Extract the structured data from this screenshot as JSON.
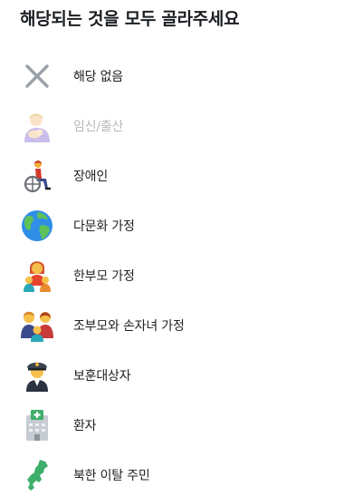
{
  "title": "해당되는 것을 모두 골라주세요",
  "options": [
    {
      "label": "해당 없음",
      "icon": "close-x-icon",
      "disabled": false
    },
    {
      "label": "임신/출산",
      "icon": "breastfeeding-icon",
      "disabled": true
    },
    {
      "label": "장애인",
      "icon": "wheelchair-user-icon",
      "disabled": false
    },
    {
      "label": "다문화 가정",
      "icon": "globe-icon",
      "disabled": false
    },
    {
      "label": "한부모 가정",
      "icon": "single-parent-family-icon",
      "disabled": false
    },
    {
      "label": "조부모와 손자녀 가정",
      "icon": "grandparent-family-icon",
      "disabled": false
    },
    {
      "label": "보훈대상자",
      "icon": "veteran-officer-icon",
      "disabled": false
    },
    {
      "label": "환자",
      "icon": "hospital-icon",
      "disabled": false
    },
    {
      "label": "북한 이탈 주민",
      "icon": "north-korea-map-icon",
      "disabled": false
    }
  ]
}
